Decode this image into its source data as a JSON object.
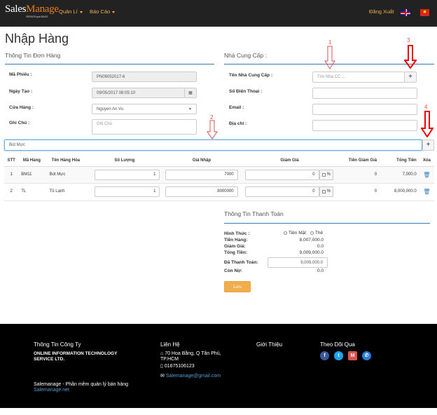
{
  "nav": {
    "logo_sales": "Sales",
    "logo_manage": "Manage",
    "logo_tagline": "GROWTH your SALES",
    "menu_quanli": "Quản Lí",
    "menu_baocao": "Báo Cáo",
    "logout": "Đăng Xuất"
  },
  "page_title": "Nhập Hàng",
  "order_info": {
    "title": "Thông Tin Đơn Hàng",
    "ma_phieu_label": "Mã Phiếu :",
    "ma_phieu_value": "PN09052017-6",
    "ngay_tao_label": "Ngày Tạo :",
    "ngay_tao_value": "09/05/2017 08:05:10",
    "cua_hang_label": "Cửa Hàng :",
    "cua_hang_value": "Nguyen An Vu",
    "ghi_chu_label": "Ghi Chú :",
    "ghi_chu_placeholder": "Ghi Chú"
  },
  "supplier": {
    "title": "Nhà Cung Cấp :",
    "name_label": "Tên Nhà Cung Cấp :",
    "name_placeholder": "Tìm Nhà CC ...",
    "phone_label": "Số Điện Thoại :",
    "email_label": "Email :",
    "address_label": "Địa chỉ :",
    "add_label": "+"
  },
  "annotations": [
    "1",
    "2",
    "3",
    "4"
  ],
  "product_search": {
    "value": "Bút Mực",
    "add_label": "+"
  },
  "table": {
    "headers": [
      "STT",
      "Mã Hàng",
      "Tên Hàng Hóa",
      "Số Lượng",
      "Giá Nhập",
      "Giảm Giá",
      "Tiền Giảm Giá",
      "Tổng Tiền",
      "Xóa"
    ],
    "rows": [
      {
        "stt": "1",
        "ma": "BM11",
        "ten": "Bút Mực",
        "sl": "1",
        "gia": "7000",
        "giam": "0",
        "pct": "%",
        "tien_giam": "0",
        "tong": "7,000.0"
      },
      {
        "stt": "2",
        "ma": "TL",
        "ten": "Tủ Lạnh",
        "sl": "1",
        "gia": "8000000",
        "giam": "0",
        "pct": "%",
        "tien_giam": "0",
        "tong": "8,000,000.0"
      }
    ]
  },
  "payment": {
    "title": "Thông Tin Thanh Toán",
    "hinh_thuc_label": "Hình Thức :",
    "tien_mat": "Tiền Mặt",
    "the": "Thẻ",
    "tien_hang_label": "Tiền Hàng:",
    "tien_hang_value": "8,007,000.0",
    "giam_gia_label": "Giảm Giá:",
    "giam_gia_value": "0.0",
    "tong_tien_label": "Tổng Tiền:",
    "tong_tien_value": "9,009,000.0",
    "da_thanh_toan_label": "Đã Thanh Toán:",
    "da_thanh_toan_value": "9,009,000.0",
    "con_no_label": "Còn Nợ:",
    "con_no_value": "0.0",
    "save": "Lưu"
  },
  "footer": {
    "company_title": "Thông Tin Công Ty",
    "company_name_1": "ONLINE INFORMATION TECHNOLOGY",
    "company_name_2": "SERVICE LTD.",
    "contact_title": "Liên Hệ",
    "address_1": "70 Hoa Bằng, Q Tân Phú,",
    "address_2": "TP.HCM",
    "phone": "01675106123",
    "email": "Salemanage@gmail.com",
    "intro_title": "Giới Thiệu",
    "follow_title": "Theo Dõi Qua",
    "slogan": "Salemanage - Phần mềm quản lý bán hàng",
    "site": "Salemanage.net"
  },
  "colors": {
    "accent": "#f0ad4e",
    "link": "#337ab7",
    "annotation": "#d9534f"
  }
}
